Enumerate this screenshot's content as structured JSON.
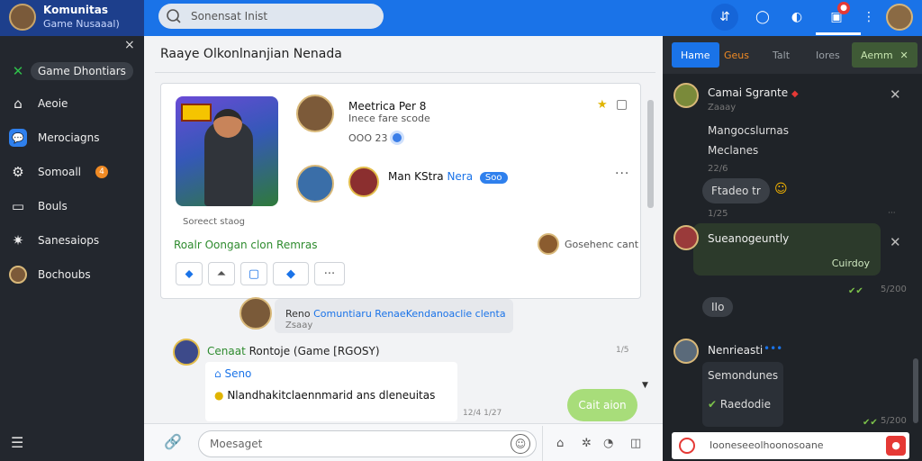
{
  "brand": {
    "title": "Komunitas",
    "subtitle": "Game Nusaaal)"
  },
  "search": {
    "placeholder": "Sonensat Inist"
  },
  "sidebar": {
    "close": "×",
    "items": [
      {
        "label": "Game Dhontiars",
        "icon": "x-icon",
        "active": true
      },
      {
        "label": "Aeoie",
        "icon": "home-icon"
      },
      {
        "label": "Merociagns",
        "icon": "chat-icon"
      },
      {
        "label": "Somoall",
        "icon": "gear-icon",
        "badge": "4"
      },
      {
        "label": "Bouls",
        "icon": "square-icon"
      },
      {
        "label": "Sanesaiops",
        "icon": "settings-icon"
      },
      {
        "label": "Bochoubs",
        "icon": "avatar-icon"
      }
    ]
  },
  "main": {
    "title": "Raaye Olkonlnanjian Nenada",
    "post": {
      "caption": "Soreect staog",
      "author": "Meetrica Per 8",
      "subtitle": "Inece fare scode",
      "number": "OOO 23",
      "row2_name": "Man KStra",
      "row2_blue": "Nera",
      "row2_pill": "Soo",
      "more": "···",
      "green_text": "Roalr Oongan clon Remras",
      "right_label": "Gosehenc cant",
      "actions_more": "···"
    },
    "notice": {
      "prefix": "Reno ",
      "blue": "Comuntiaru RenaeKendanoaclie clenta",
      "sub": "Zsaay"
    },
    "message": {
      "green": "Cenaat",
      "text": " Rontoje (Game [RGOSY)",
      "time1": "1/5",
      "reply_title": "Seno",
      "reply_body": "Nlandhakitclaennmarid ans dleneuitas",
      "time2": "12/4 1/27",
      "bubble": "Cait aion"
    },
    "composer": {
      "placeholder": "Moesaget"
    }
  },
  "rpanel": {
    "tabs": [
      "Hame",
      "Geus",
      "Talt",
      "Iores",
      "Aemm"
    ],
    "m1": {
      "name": "Camai Sgrante",
      "sub": "Zaaay",
      "l1": "Mangocslurnas",
      "l2": "Meclanes",
      "t1": "22/6",
      "pill": "Ftadeo tr",
      "t2": "1/25"
    },
    "m2": {
      "name": "Sueanogeuntly",
      "box": "Cuirdoy",
      "t": "5/200"
    },
    "pill2": "IIo",
    "m3": {
      "name": "Nenrieasti",
      "l1": "Semondunes",
      "l2": "Raedodie",
      "t": "5/200"
    },
    "composer": {
      "placeholder": "Iooneseeolhoonosoane"
    }
  },
  "colors": {
    "accent": "#1a73e8",
    "sidebar_bg": "#23272e",
    "panel_bg": "#1f2328",
    "green": "#2e8b2e"
  }
}
